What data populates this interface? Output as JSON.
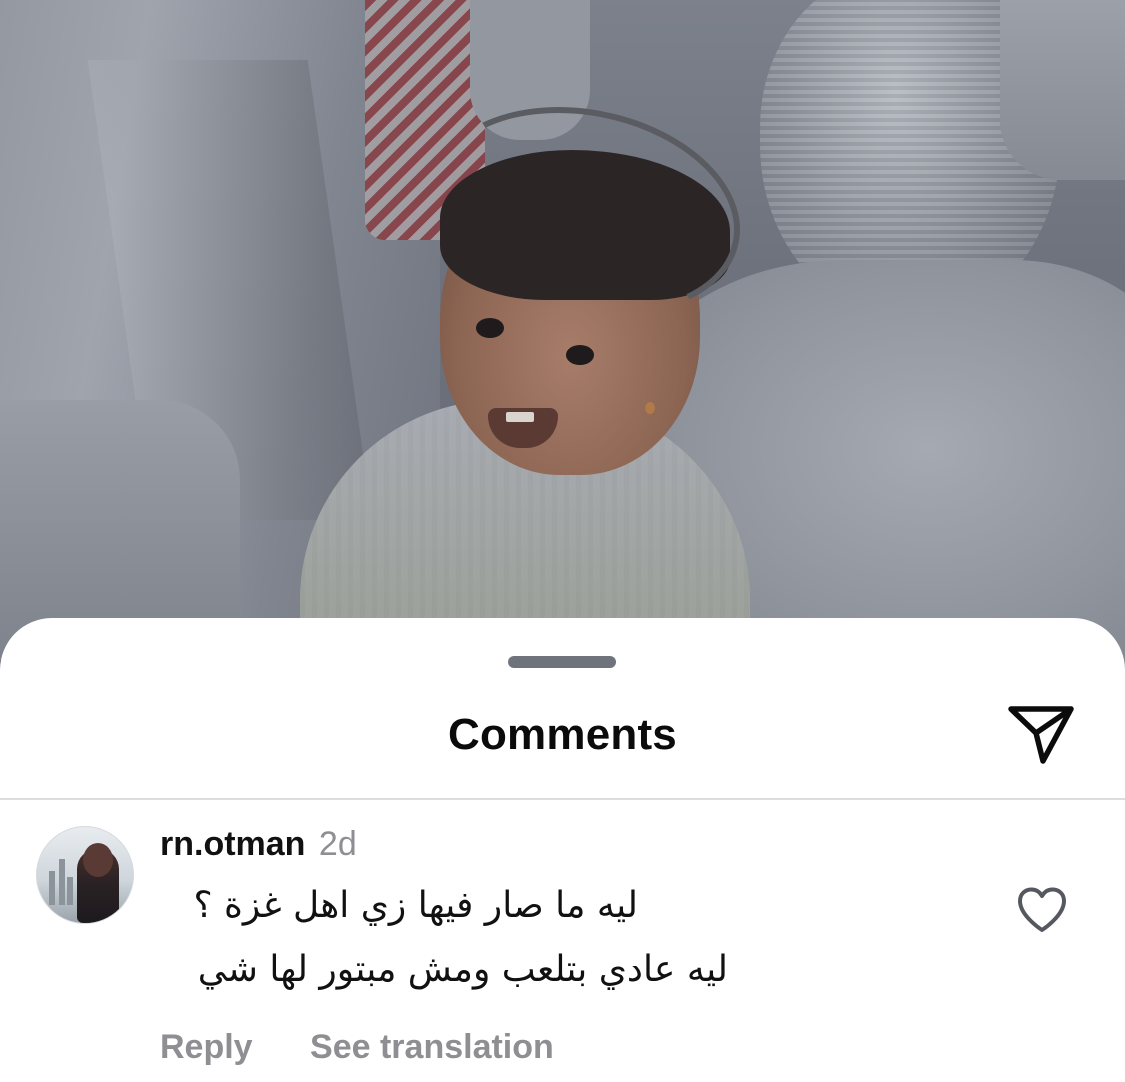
{
  "sheet": {
    "title": "Comments"
  },
  "comment": {
    "username": "rn.otman",
    "time": "2d",
    "text_line_1": "ليه ما صار فيها زي اهل غزة ؟",
    "text_line_2": "ليه عادي بتلعب ومش مبتور لها شي",
    "reply_label": "Reply",
    "translate_label": "See translation"
  },
  "icons": {
    "share": "paper-plane-icon",
    "like": "heart-outline-icon"
  },
  "colors": {
    "title": "#0b0b0b",
    "secondary_text": "#8e8e93",
    "divider": "#dcdde0",
    "grabber": "#6f737b",
    "sheet_background": "#ffffff"
  }
}
